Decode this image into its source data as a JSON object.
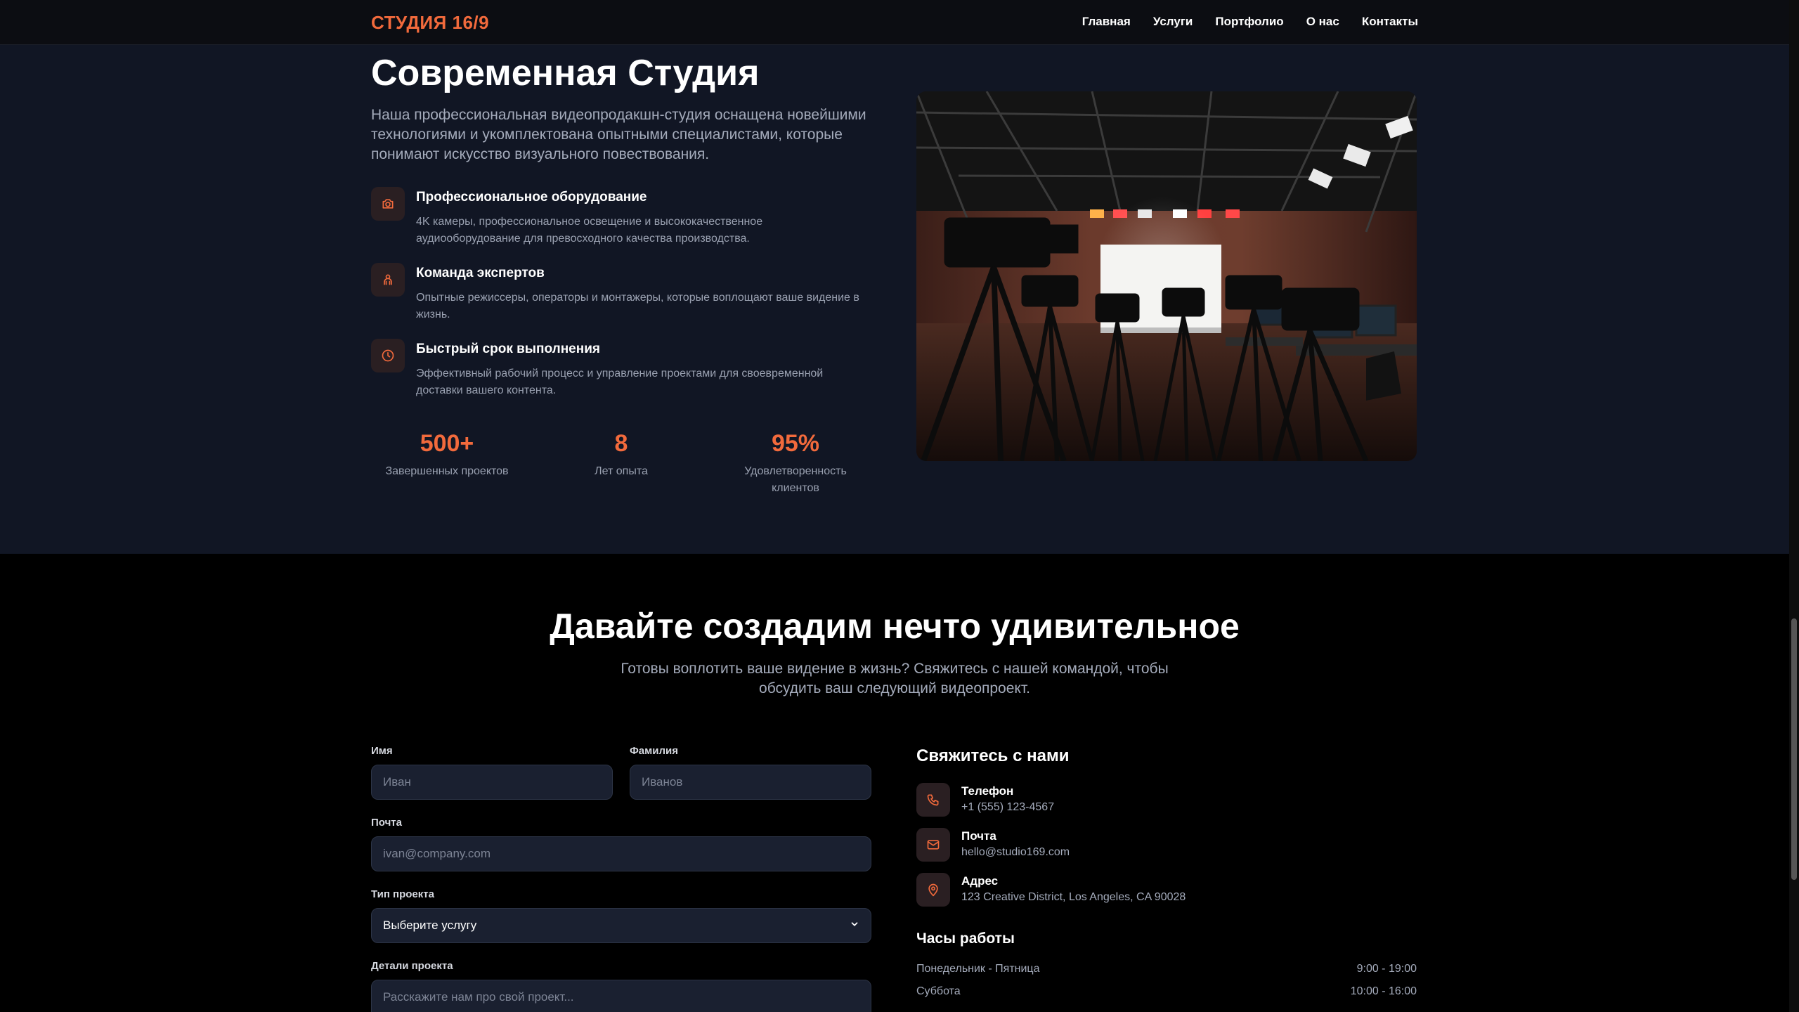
{
  "nav": {
    "brand": "СТУДИЯ 16/9",
    "links": [
      "Главная",
      "Услуги",
      "Портфолио",
      "О нас",
      "Контакты"
    ]
  },
  "about": {
    "title": "Современная Студия",
    "description": "Наша профессиональная видеопродакшн-студия оснащена новейшими технологиями и укомплектована опытными специалистами, которые понимают искусство визуального повествования.",
    "features": [
      {
        "icon": "camera-icon",
        "title": "Профессиональное оборудование",
        "text": "4K камеры, профессиональное освещение и высококачественное аудиооборудование для превосходного качества производства."
      },
      {
        "icon": "team-icon",
        "title": "Команда экспертов",
        "text": "Опытные режиссеры, операторы и монтажеры, которые воплощают ваше видение в жизнь."
      },
      {
        "icon": "clock-icon",
        "title": "Быстрый срок выполнения",
        "text": "Эффективный рабочий процесс и управление проектами для своевременной доставки вашего контента."
      }
    ],
    "stats": [
      {
        "value": "500+",
        "label": "Завершенных проектов"
      },
      {
        "value": "8",
        "label": "Лет опыта"
      },
      {
        "value": "95%",
        "label": "Удовлетворенность клиентов"
      }
    ]
  },
  "contact": {
    "title": "Давайте создадим нечто удивительное",
    "subtitle": "Готовы воплотить ваше видение в жизнь? Свяжитесь с нашей командой, чтобы обсудить ваш следующий видеопроект.",
    "form": {
      "first_name_label": "Имя",
      "first_name_placeholder": "Иван",
      "last_name_label": "Фамилия",
      "last_name_placeholder": "Иванов",
      "email_label": "Почта",
      "email_placeholder": "ivan@company.com",
      "project_type_label": "Тип проекта",
      "project_type_value": "Выберите услугу",
      "details_label": "Детали проекта",
      "details_placeholder": "Расскажите нам про свой проект..."
    },
    "info": {
      "title": "Свяжитесь с нами",
      "phone_label": "Телефон",
      "phone": "+1 (555) 123-4567",
      "email_label": "Почта",
      "email": "hello@studio169.com",
      "address_label": "Адрес",
      "address": "123 Creative District, Los Angeles, CA 90028"
    },
    "hours": {
      "title": "Часы работы",
      "rows": [
        {
          "day": "Понедельник - Пятница",
          "time": "9:00 - 19:00"
        },
        {
          "day": "Суббота",
          "time": "10:00 - 16:00"
        }
      ]
    }
  },
  "colors": {
    "accent": "#f26a3c",
    "nav_bg": "#0c0d12",
    "about_bg": "#111624",
    "contact_bg": "#000000",
    "field_bg": "#1a2030"
  }
}
